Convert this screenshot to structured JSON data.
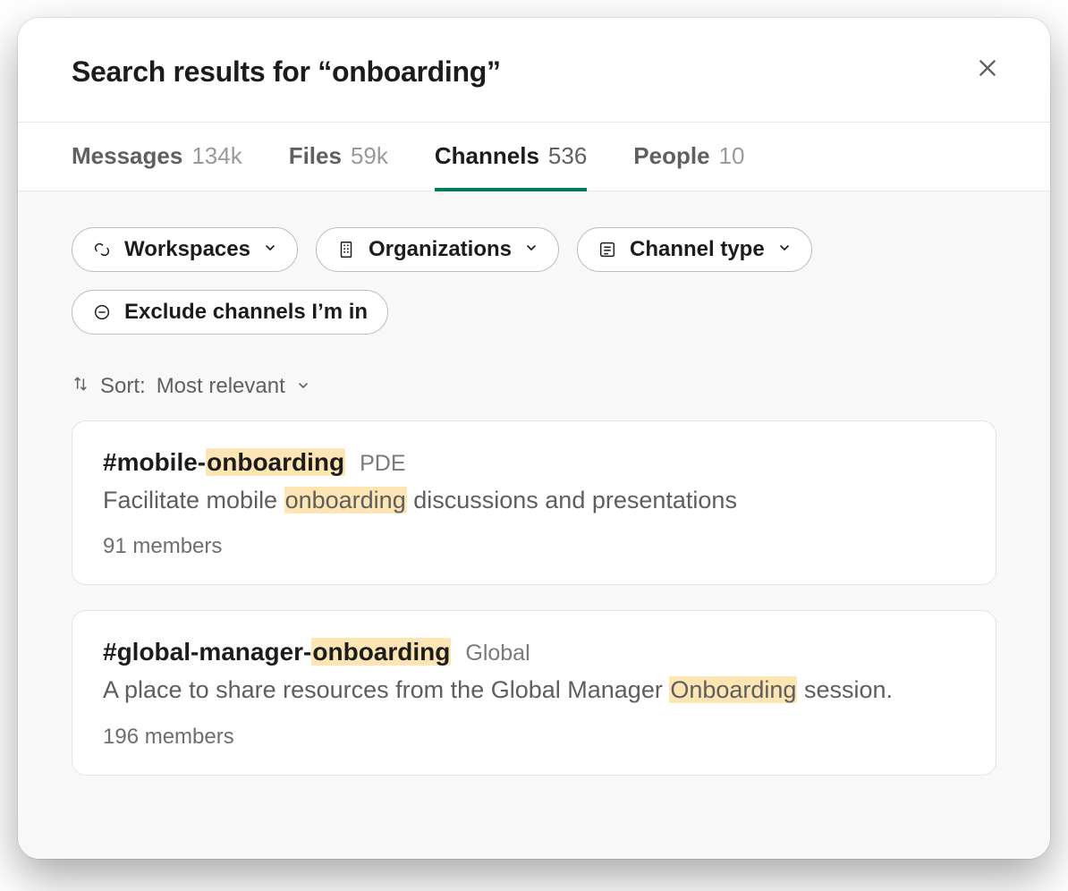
{
  "header": {
    "title_prefix": "Search results for “",
    "query": "onboarding",
    "title_suffix": "”"
  },
  "tabs": [
    {
      "id": "messages",
      "label": "Messages",
      "count": "134k",
      "active": false
    },
    {
      "id": "files",
      "label": "Files",
      "count": "59k",
      "active": false
    },
    {
      "id": "channels",
      "label": "Channels",
      "count": "536",
      "active": true
    },
    {
      "id": "people",
      "label": "People",
      "count": "10",
      "active": false
    }
  ],
  "filters": [
    {
      "id": "workspaces",
      "label": "Workspaces",
      "icon": "workspace",
      "has_chevron": true
    },
    {
      "id": "organizations",
      "label": "Organizations",
      "icon": "organization",
      "has_chevron": true
    },
    {
      "id": "channel-type",
      "label": "Channel type",
      "icon": "channel-type",
      "has_chevron": true
    },
    {
      "id": "exclude-mine",
      "label": "Exclude channels I’m in",
      "icon": "exclude",
      "has_chevron": false
    }
  ],
  "sort": {
    "prefix": "Sort:",
    "value": "Most relevant"
  },
  "highlight_term": "onboarding",
  "results": [
    {
      "name": "#mobile-onboarding",
      "workspace": "PDE",
      "description": "Facilitate mobile onboarding discussions and presentations",
      "members": "91 members"
    },
    {
      "name": "#global-manager-onboarding",
      "workspace": "Global",
      "description": "A place to share resources from the Global Manager Onboarding session.",
      "members": "196 members"
    }
  ]
}
